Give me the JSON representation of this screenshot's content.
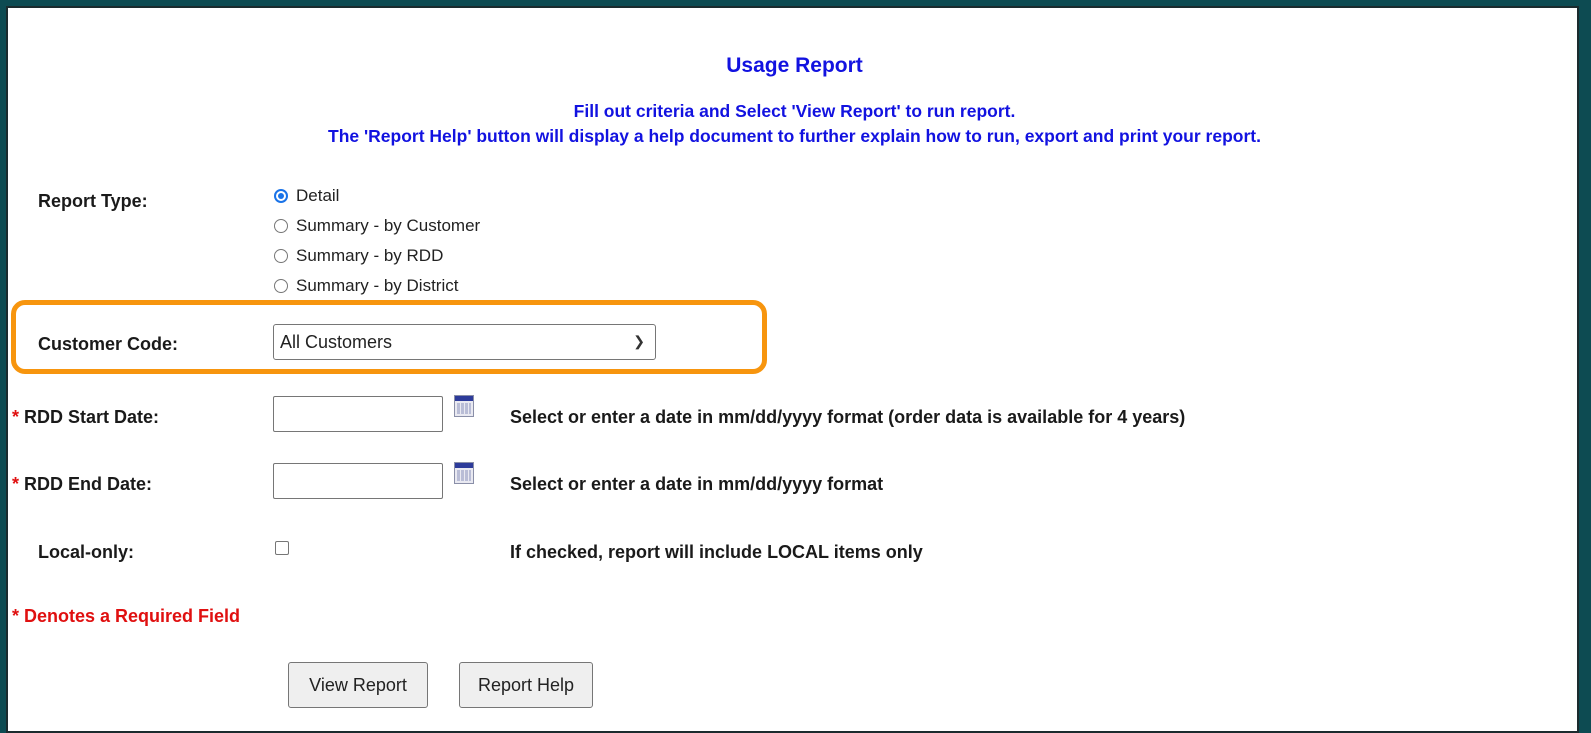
{
  "header": {
    "title": "Usage Report",
    "instruction_line1": "Fill out criteria and Select 'View Report' to run report.",
    "instruction_line2": "The 'Report Help' button will display a help document to further explain how to run, export and print your report."
  },
  "report_type": {
    "label": "Report Type:",
    "options": [
      {
        "label": "Detail",
        "checked": true
      },
      {
        "label": "Summary - by Customer",
        "checked": false
      },
      {
        "label": "Summary - by RDD",
        "checked": false
      },
      {
        "label": "Summary - by District",
        "checked": false
      }
    ]
  },
  "customer_code": {
    "label": "Customer Code:",
    "selected": "All Customers"
  },
  "rdd_start": {
    "asterisk": "*",
    "label": "RDD Start Date:",
    "value": "",
    "hint": "Select or enter a date in mm/dd/yyyy format (order data is available for 4 years)"
  },
  "rdd_end": {
    "asterisk": "*",
    "label": "RDD End Date:",
    "value": "",
    "hint": "Select or enter a date in mm/dd/yyyy format"
  },
  "local_only": {
    "label": "Local-only:",
    "checked": false,
    "hint": "If checked, report will include LOCAL items only"
  },
  "required_note": "* Denotes a Required Field",
  "buttons": {
    "view_report": "View Report",
    "report_help": "Report Help"
  },
  "colors": {
    "heading_blue": "#1212e0",
    "required_red": "#e01010",
    "highlight_orange": "#f7950e",
    "radio_blue": "#1a73e8"
  }
}
